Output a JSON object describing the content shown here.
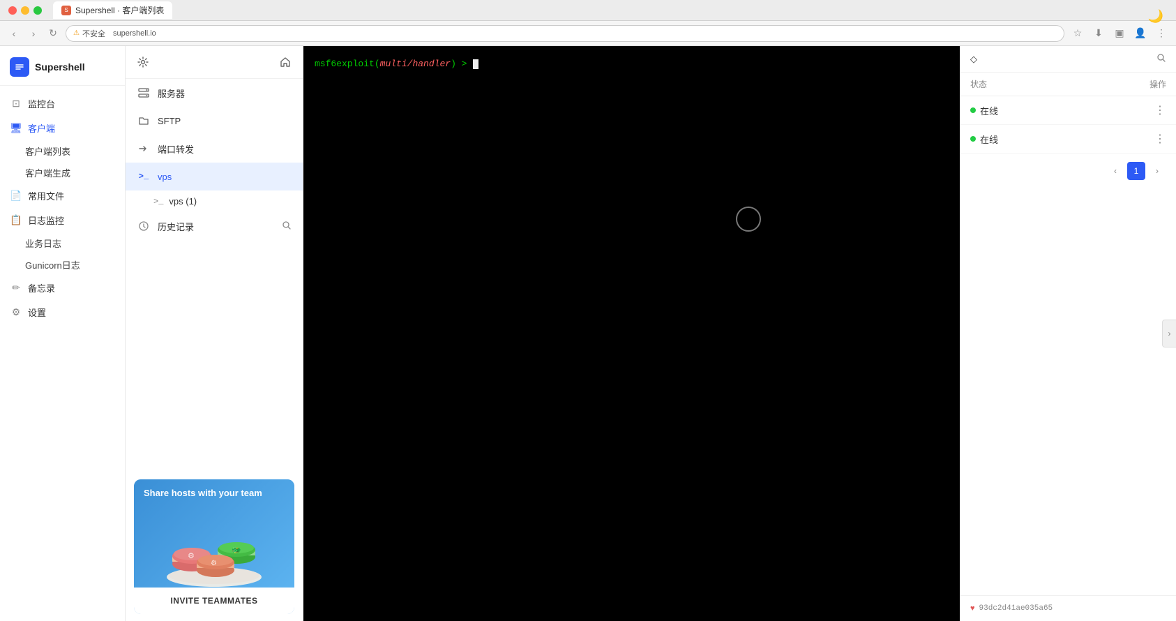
{
  "browser": {
    "traffic_lights": [
      "close",
      "minimize",
      "maximize"
    ],
    "tab_label": "Supershell · 客户端列表",
    "address": "不安全",
    "address_url": "supershell.io",
    "dark_mode_label": "🌙"
  },
  "sidebar": {
    "logo": "Supershell",
    "logo_icon": "S",
    "nav_items": [
      {
        "key": "monitor",
        "label": "监控台",
        "icon": "⊡"
      },
      {
        "key": "client",
        "label": "客户端",
        "icon": "🖥"
      },
      {
        "key": "client-list",
        "label": "客户端列表",
        "indent": true
      },
      {
        "key": "client-gen",
        "label": "客户端生成",
        "indent": true
      },
      {
        "key": "files",
        "label": "常用文件",
        "icon": "📄"
      },
      {
        "key": "logs",
        "label": "日志监控",
        "icon": "📋"
      },
      {
        "key": "biz-logs",
        "label": "业务日志",
        "indent": true
      },
      {
        "key": "gunicorn-logs",
        "label": "Gunicorn日志",
        "indent": true
      },
      {
        "key": "notes",
        "label": "备忘录",
        "icon": "✏"
      },
      {
        "key": "settings",
        "label": "设置",
        "icon": "⚙"
      }
    ]
  },
  "middle_panel": {
    "gear_icon": "⚙",
    "home_icon": "🏠",
    "menu_items": [
      {
        "key": "servers",
        "label": "服务器",
        "icon": "▦",
        "type": "grid"
      },
      {
        "key": "sftp",
        "label": "SFTP",
        "icon": "📁",
        "type": "folder"
      },
      {
        "key": "port-forward",
        "label": "端口转发",
        "icon": "→",
        "type": "arrow"
      },
      {
        "key": "vps",
        "label": "vps",
        "icon": ">_",
        "active": true,
        "type": "terminal"
      }
    ],
    "vps_sub": [
      {
        "key": "vps1",
        "label": "vps (1)"
      }
    ],
    "history": {
      "label": "历史记录",
      "search_icon": "🔍"
    },
    "invite_card": {
      "title": "Share hosts with your team",
      "button_label": "INVITE TEAMMATES"
    }
  },
  "terminal": {
    "prompt_msf6": "msf6",
    "prompt_exploit": "exploit",
    "prompt_module": "multi/handler",
    "prompt_arrow": ">",
    "prompt_gt": ">"
  },
  "right_panel": {
    "status_col": "状态",
    "ops_col": "操作",
    "sort_icon": "◇",
    "search_icon": "🔍",
    "rows": [
      {
        "status": "在线",
        "online": true
      },
      {
        "status": "在线",
        "online": true
      }
    ],
    "pagination": {
      "prev": "‹",
      "page": "1",
      "next": "›"
    },
    "footer_heart": "♥",
    "footer_hash": "93dc2d41ae035a65"
  }
}
